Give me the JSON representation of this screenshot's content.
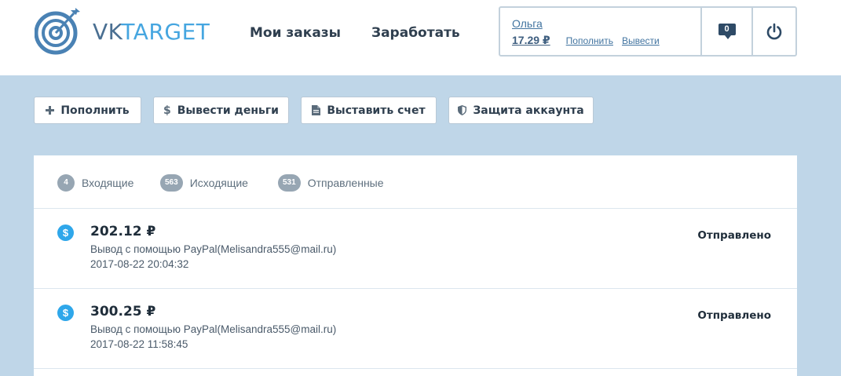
{
  "header": {
    "logo": {
      "vk": "VK",
      "target": "TARGET"
    },
    "nav": {
      "orders": "Мои заказы",
      "earn": "Заработать"
    },
    "user": {
      "name": "Ольга",
      "balance": "17.29 ₽",
      "topup_link": "Пополнить",
      "withdraw_link": "Вывести",
      "messages_count": "0",
      "icons": {
        "messages": "chat-bubble-icon",
        "logout": "power-icon"
      }
    }
  },
  "actions": [
    {
      "label": "Пополнить",
      "icon": "plus-icon"
    },
    {
      "label": "Вывести деньги",
      "icon": "dollar-icon"
    },
    {
      "label": "Выставить счет",
      "icon": "document-icon"
    },
    {
      "label": "Защита аккаунта",
      "icon": "shield-icon"
    }
  ],
  "tabs": [
    {
      "count": "4",
      "label": "Входящие"
    },
    {
      "count": "563",
      "label": "Исходящие"
    },
    {
      "count": "531",
      "label": "Отправленные"
    }
  ],
  "transactions": [
    {
      "amount": "202.12 ₽",
      "description": "Вывод с помощью PayPal(Melisandra555@mail.ru)",
      "date": "2017-08-22 20:04:32",
      "status": "Отправлено"
    },
    {
      "amount": "300.25 ₽",
      "description": "Вывод с помощью PayPal(Melisandra555@mail.ru)",
      "date": "2017-08-22 11:58:45",
      "status": "Отправлено"
    }
  ],
  "colors": {
    "accent": "#2fa7ea",
    "background": "#bfd6e8",
    "logo_blue": "#4a82b4"
  }
}
